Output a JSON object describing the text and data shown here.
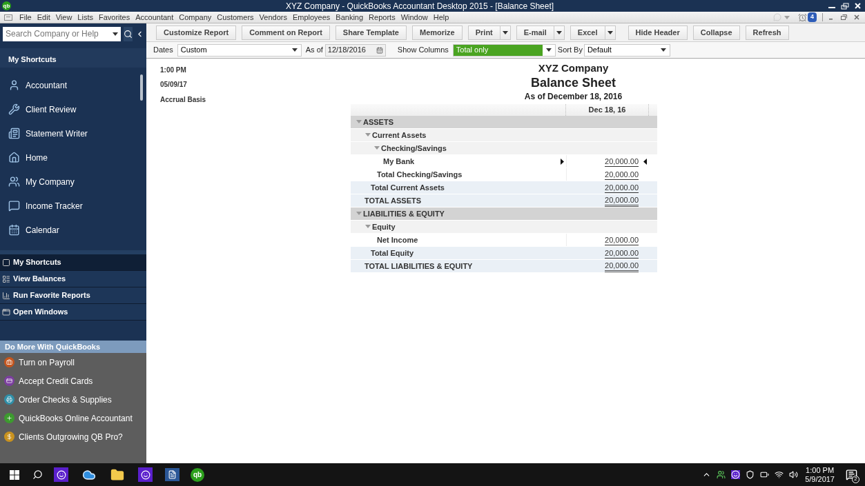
{
  "window": {
    "logo": "qb",
    "title": "XYZ Company  - QuickBooks Accountant Desktop 2015 - [Balance Sheet]"
  },
  "menu": [
    "File",
    "Edit",
    "View",
    "Lists",
    "Favorites",
    "Accountant",
    "Company",
    "Customers",
    "Vendors",
    "Employees",
    "Banking",
    "Reports",
    "Window",
    "Help"
  ],
  "reminders": {
    "count": "4"
  },
  "sidebar": {
    "search": {
      "placeholder": "Search Company or Help"
    },
    "heading": "My Shortcuts",
    "shortcuts": [
      "Accountant",
      "Client Review",
      "Statement Writer",
      "Home",
      "My Company",
      "Income Tracker",
      "Calendar"
    ],
    "nav": [
      {
        "label": "My Shortcuts",
        "selected": true
      },
      {
        "label": "View Balances",
        "selected": false
      },
      {
        "label": "Run Favorite Reports",
        "selected": false
      },
      {
        "label": "Open Windows",
        "selected": false
      }
    ],
    "promo": {
      "heading": "Do More With QuickBooks",
      "items": [
        {
          "label": "Turn on Payroll",
          "color": "#c4561f"
        },
        {
          "label": "Accept Credit Cards",
          "color": "#7b3f9e"
        },
        {
          "label": "Order Checks & Supplies",
          "color": "#2f8fa8"
        },
        {
          "label": "QuickBooks Online Accountant",
          "color": "#3d9b2f"
        },
        {
          "label": "Clients Outgrowing QB Pro?",
          "color": "#c9921f"
        }
      ]
    }
  },
  "toolbar": [
    {
      "label": "Customize Report",
      "kind": "button"
    },
    {
      "label": "Comment on Report",
      "kind": "button"
    },
    {
      "label": "Share Template",
      "kind": "button"
    },
    {
      "label": "Memorize",
      "kind": "button"
    },
    {
      "label": "Print",
      "kind": "split"
    },
    {
      "label": "E-mail",
      "kind": "split"
    },
    {
      "label": "Excel",
      "kind": "split"
    },
    {
      "label": "Hide Header",
      "kind": "button"
    },
    {
      "label": "Collapse",
      "kind": "button"
    },
    {
      "label": "Refresh",
      "kind": "button"
    }
  ],
  "filters": {
    "dates_label": "Dates",
    "dates": "Custom",
    "as_of_label": "As of",
    "as_of": "12/18/2016",
    "columns_label": "Show Columns",
    "columns": "Total only",
    "sort_label": "Sort By",
    "sort": "Default"
  },
  "report": {
    "time": "1:00 PM",
    "date": "05/09/17",
    "basis": "Accrual Basis",
    "company": "XYZ Company",
    "title": "Balance Sheet",
    "subtitle": "As of December 18, 2016",
    "column": "Dec 18, 16",
    "rows": [
      {
        "label": "ASSETS",
        "kind": "section",
        "expanded": true,
        "selected": false,
        "children": [
          {
            "label": "Current Assets",
            "kind": "group",
            "expanded": true,
            "selected": false,
            "children": [
              {
                "label": "Checking/Savings",
                "kind": "group",
                "expanded": true,
                "selected": false,
                "children": [
                  {
                    "label": "My Bank",
                    "kind": "account",
                    "amount": "20,000.00",
                    "selected": true
                  }
                ]
              },
              {
                "label": "Total Checking/Savings",
                "kind": "account",
                "amount": "20,000.00",
                "selected": false
              }
            ]
          },
          {
            "label": "Total Current Assets",
            "kind": "subtotal",
            "amount": "20,000.00",
            "selected": false
          }
        ]
      },
      {
        "label": "TOTAL ASSETS",
        "kind": "total",
        "amount": "20,000.00",
        "selected": false
      },
      {
        "label": "LIABILITIES & EQUITY",
        "kind": "section",
        "expanded": true,
        "selected": false,
        "children": [
          {
            "label": "Equity",
            "kind": "group",
            "expanded": true,
            "selected": false,
            "children": [
              {
                "label": "Net Income",
                "kind": "account",
                "amount": "20,000.00",
                "selected": false
              }
            ]
          },
          {
            "label": "Total Equity",
            "kind": "subtotal",
            "amount": "20,000.00",
            "selected": false
          }
        ]
      },
      {
        "label": "TOTAL LIABILITIES & EQUITY",
        "kind": "total",
        "amount": "20,000.00",
        "selected": false
      }
    ]
  },
  "taskbar": {
    "app_logo": "qb",
    "time": "1:00 PM",
    "date": "5/9/2017",
    "notifications": "2"
  }
}
